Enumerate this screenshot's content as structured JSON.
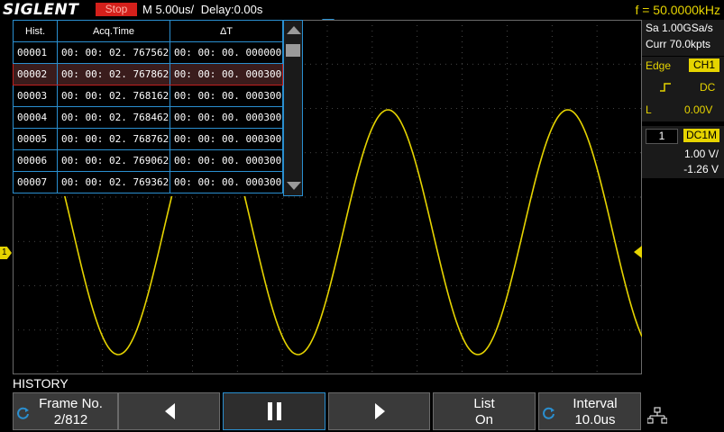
{
  "header": {
    "brand": "SIGLENT",
    "run_state": "Stop",
    "timebase": "M 5.00us/",
    "delay": "Delay:0.00s",
    "frequency": "f = 50.0000kHz"
  },
  "acquisition": {
    "sample_rate": "Sa 1.00GSa/s",
    "memory": "Curr 70.0kpts"
  },
  "trigger": {
    "type": "Edge",
    "source": "CH1",
    "coupling": "DC",
    "level_label": "L",
    "level": "0.00V"
  },
  "channel": {
    "number": "1",
    "coupling": "DC1M",
    "scale": "1.00 V/",
    "offset": "-1.26 V"
  },
  "history_table": {
    "columns": [
      "Hist.",
      "Acq.Time",
      "ΔT"
    ],
    "rows": [
      {
        "hist": "00001",
        "acq_time": "00: 00: 02. 767562",
        "dt": "00: 00: 00. 000000"
      },
      {
        "hist": "00002",
        "acq_time": "00: 00: 02. 767862",
        "dt": "00: 00: 00. 000300"
      },
      {
        "hist": "00003",
        "acq_time": "00: 00: 02. 768162",
        "dt": "00: 00: 00. 000300"
      },
      {
        "hist": "00004",
        "acq_time": "00: 00: 02. 768462",
        "dt": "00: 00: 00. 000300"
      },
      {
        "hist": "00005",
        "acq_time": "00: 00: 02. 768762",
        "dt": "00: 00: 00. 000300"
      },
      {
        "hist": "00006",
        "acq_time": "00: 00: 02. 769062",
        "dt": "00: 00: 00. 000300"
      },
      {
        "hist": "00007",
        "acq_time": "00: 00: 02. 769362",
        "dt": "00: 00: 00. 000300"
      }
    ],
    "selected_row": 2
  },
  "mode_label": "HISTORY",
  "softkeys": {
    "frame_label": "Frame No.",
    "frame_value": "2/812",
    "list_label": "List",
    "list_value": "On",
    "interval_label": "Interval",
    "interval_value": "10.0us"
  },
  "colors": {
    "trace": "#e6d400",
    "grid": "#5a5a5a",
    "accent": "#2a8fd0",
    "stop": "#d4201b"
  }
}
